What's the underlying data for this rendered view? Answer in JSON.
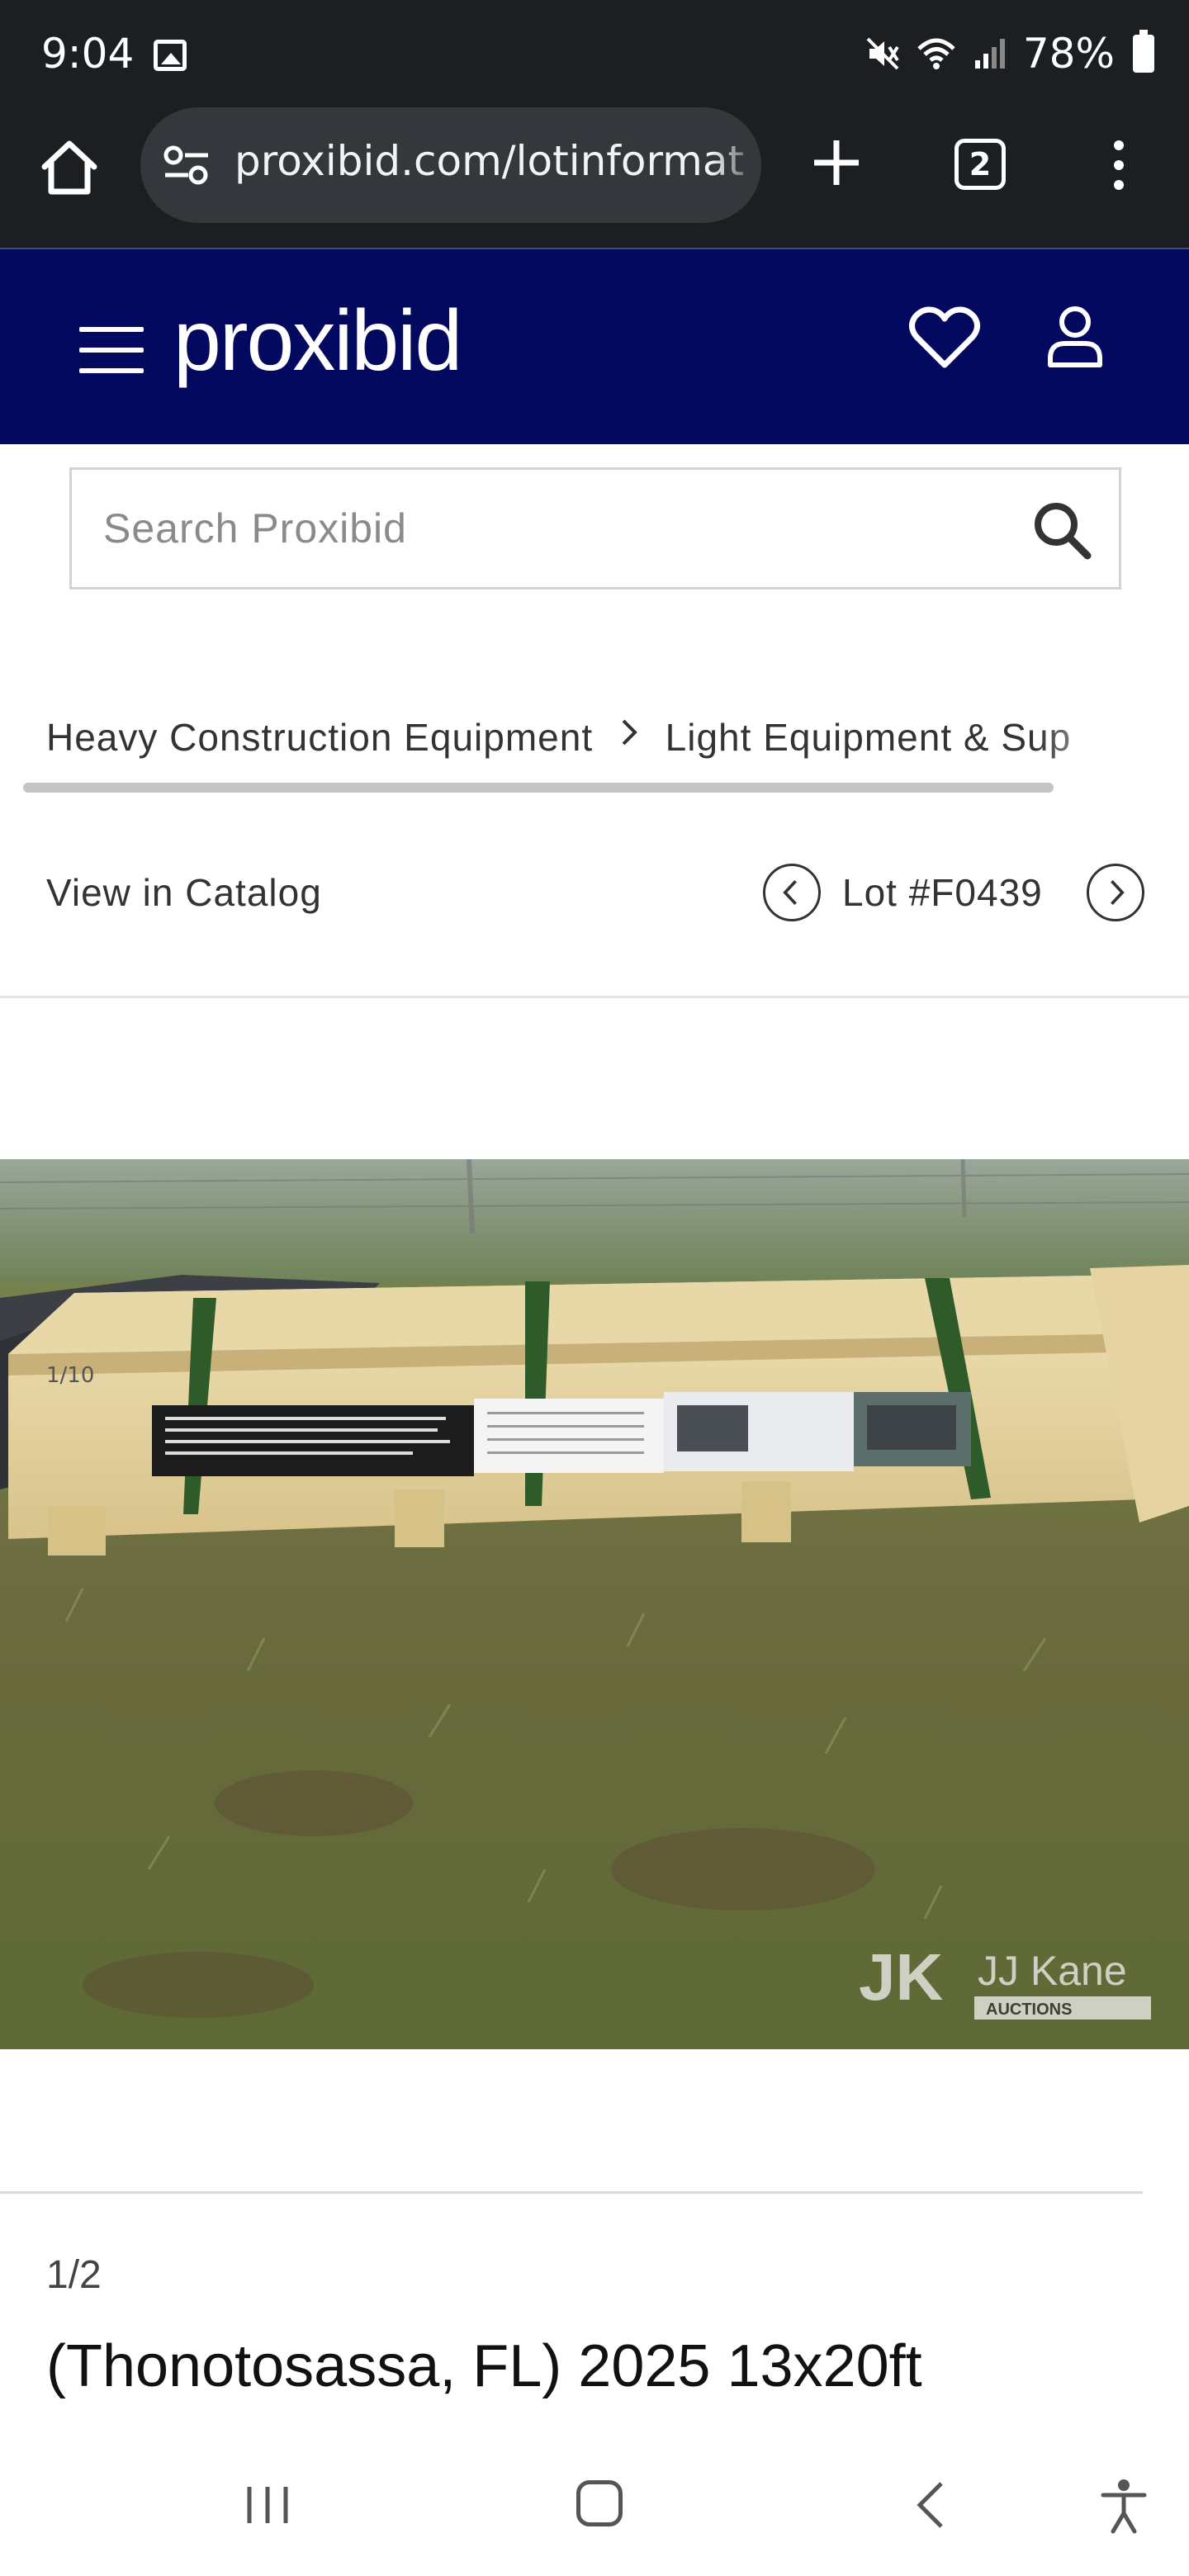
{
  "status_bar": {
    "time": "9:04",
    "battery": "78%",
    "icons": [
      "gallery-icon",
      "mute-icon",
      "wifi-icon",
      "signal-icon",
      "battery-icon"
    ]
  },
  "browser": {
    "url": "proxibid.com/lotinformat",
    "tab_count": "2"
  },
  "header": {
    "logo": "proxibid",
    "brand_color": "#02095e"
  },
  "search": {
    "placeholder": "Search Proxibid"
  },
  "breadcrumb": {
    "items": [
      "Heavy Construction Equipment",
      "Light Equipment & Sup"
    ]
  },
  "catalog": {
    "view_label": "View in Catalog",
    "lot_label": "Lot #F0439"
  },
  "image": {
    "counter": "1/2",
    "watermark_main": "JJ Kane",
    "watermark_sub": "AUCTIONS",
    "crate_marking": "1/10"
  },
  "lot": {
    "title": "(Thonotosassa, FL) 2025 13x20ft"
  }
}
